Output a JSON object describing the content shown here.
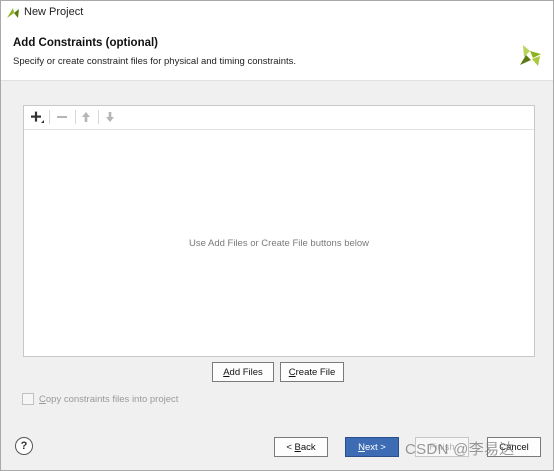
{
  "window": {
    "title": "New Project"
  },
  "header": {
    "heading": "Add Constraints (optional)",
    "subheading": "Specify or create constraint files for physical and timing constraints."
  },
  "toolbar": {
    "items": [
      {
        "name": "add",
        "icon": "plus-icon",
        "enabled": true
      },
      {
        "name": "remove",
        "icon": "minus-icon",
        "enabled": false
      },
      {
        "name": "move-up",
        "icon": "arrow-up-icon",
        "enabled": false
      },
      {
        "name": "move-down",
        "icon": "arrow-down-icon",
        "enabled": false
      }
    ]
  },
  "file_list": {
    "empty_message": "Use Add Files or Create File buttons below"
  },
  "actions": {
    "add_files": {
      "mnemonic": "A",
      "rest": "dd Files"
    },
    "create_file": {
      "mnemonic": "C",
      "rest": "reate File"
    }
  },
  "options": {
    "copy_into_project": {
      "label_mnemonic": "C",
      "label_rest": "opy constraints files into project",
      "checked": false,
      "enabled": false
    }
  },
  "footer": {
    "help": "?",
    "back": {
      "prefix": "< ",
      "mnemonic": "B",
      "rest": "ack"
    },
    "next": {
      "mnemonic": "N",
      "rest": "ext >"
    },
    "finish": "Finish",
    "cancel": "Cancel"
  },
  "watermark": "CSDN @李易达",
  "colors": {
    "primary_button": "#3d6cb5",
    "logo_green": "#8bb31d",
    "logo_dark": "#5c7a12"
  }
}
